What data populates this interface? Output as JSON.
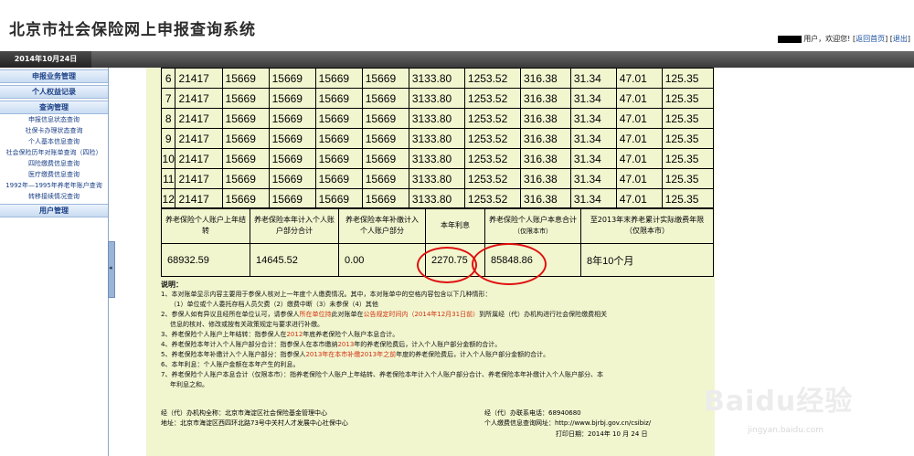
{
  "header": {
    "title": "北京市社会保险网上申报查询系统",
    "user_suffix": "用户，欢迎您!",
    "home_link": "返回首页",
    "logout_link": "退出"
  },
  "datebar": {
    "date": "2014年10月24日"
  },
  "sidebar": {
    "sec_declare": "申报业务管理",
    "sec_rights": "个人权益记录",
    "sec_query": "查询管理",
    "query_items": [
      "申报信息状态查询",
      "社保卡办理状态查询",
      "个人基本信息查询",
      "社会保险历年对账单查询（四险）",
      "四险缴费信息查询",
      "医疗缴费信息查询",
      "1992年—1995年养老年账户查询",
      "转移接续情况查询"
    ],
    "sec_user": "用户管理"
  },
  "monthly_table": {
    "rows": [
      [
        "6",
        "21417",
        "15669",
        "15669",
        "15669",
        "15669",
        "3133.80",
        "1253.52",
        "316.38",
        "31.34",
        "47.01",
        "125.35"
      ],
      [
        "7",
        "21417",
        "15669",
        "15669",
        "15669",
        "15669",
        "3133.80",
        "1253.52",
        "316.38",
        "31.34",
        "47.01",
        "125.35"
      ],
      [
        "8",
        "21417",
        "15669",
        "15669",
        "15669",
        "15669",
        "3133.80",
        "1253.52",
        "316.38",
        "31.34",
        "47.01",
        "125.35"
      ],
      [
        "9",
        "21417",
        "15669",
        "15669",
        "15669",
        "15669",
        "3133.80",
        "1253.52",
        "316.38",
        "31.34",
        "47.01",
        "125.35"
      ],
      [
        "10",
        "21417",
        "15669",
        "15669",
        "15669",
        "15669",
        "3133.80",
        "1253.52",
        "316.38",
        "31.34",
        "47.01",
        "125.35"
      ],
      [
        "11",
        "21417",
        "15669",
        "15669",
        "15669",
        "15669",
        "3133.80",
        "1253.52",
        "316.38",
        "31.34",
        "47.01",
        "125.35"
      ],
      [
        "12",
        "21417",
        "15669",
        "15669",
        "15669",
        "15669",
        "3133.80",
        "1253.52",
        "316.38",
        "31.34",
        "47.01",
        "125.35"
      ]
    ]
  },
  "summary": {
    "headers": [
      "养老保险个人账户上年结转",
      "养老保险本年计入个人账户部分合计",
      "养老保险本年补缴计入个人账户部分",
      "本年利息",
      "养老保险个人账户本息合计",
      "至2013年末养老累计实际缴费年限（仅限本市）"
    ],
    "header_small": "（仅限本市）",
    "values": [
      "68932.59",
      "14645.52",
      "0.00",
      "2270.75",
      "85848.86",
      "8年10个月"
    ]
  },
  "notes": {
    "title": "说明：",
    "n1": "1、本对账单显示内容主要用于参保人核对上一年度个人缴费情况。其中，本对账单中的空格内容包含以下几种情形：",
    "n1b": "（1）单位或个人委托存档人员欠费（2）缴费中断（3）未参保（4）其他",
    "n2a": "2、参保人如有异议且经所在单位认可，请参保人",
    "n2b": "所在单位持",
    "n2c": "此对账单在",
    "n2d": "公告规定时间内（2014年12月31日前）",
    "n2e": "到所属经（代）办机构进行社会保险缴费相关",
    "n2f": "信息的核对、修改或按有关政策规定与要求进行补缴。",
    "n3a": "3、养老保险个人账户上年结转：指参保人在",
    "n3b": "2012",
    "n3c": "年底养老保险个人账户本息合计。",
    "n4a": "4、养老保险本年计入个人账户部分合计：指参保人在本市缴纳",
    "n4b": "2013",
    "n4c": "年的养老保险费后，计入个人账户部分金额的合计。",
    "n5a": "5、养老保险本年补缴计入个人账户部分：指参保人",
    "n5b": "2013年在本市补缴2013年之前",
    "n5c": "年度的养老保险费后，计入个人账户部分金额的合计。",
    "n6": "6、本年利息：个人账户金额在本年产生的利息。",
    "n7": "7、养老保险个人账户本息合计（仅限本市）：指养老保险个人账户上年结转、养老保险本年计入个人账户部分合计、养老保险本年补缴计入个人账户部分、本",
    "n7b": "年利息之和。"
  },
  "footer": {
    "agency": "经（代）办机构全称：北京市海淀区社会保险基金管理中心",
    "address": "地址：北京市海淀区西四环北路73号中关村人才发展中心社保中心",
    "phone": "经（代）办联系电话：68940680",
    "website": "个人缴费信息查询网址：http://www.bjrbj.gov.cn/csibiz/",
    "print_date": "打印日期：2014年  10  月  24  日"
  },
  "watermark": {
    "brand": "Baidu经验",
    "url": "jingyan.baidu.com"
  }
}
